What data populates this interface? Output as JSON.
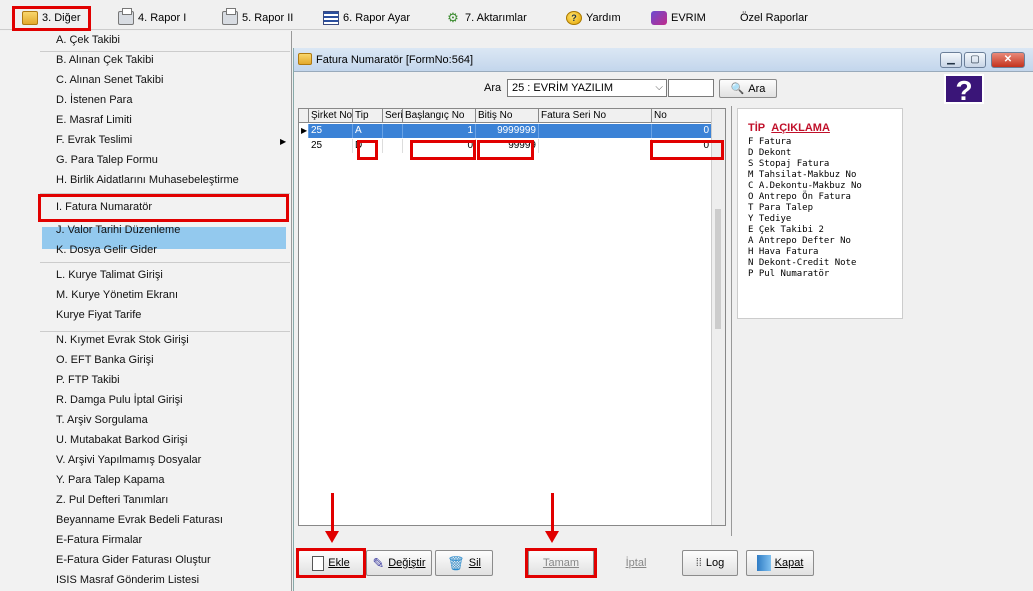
{
  "menubar": {
    "items": [
      {
        "label": "3. Diğer",
        "icon": "folder-icon"
      },
      {
        "label": "4. Rapor I",
        "icon": "printer-icon"
      },
      {
        "label": "5. Rapor II",
        "icon": "printer-icon"
      },
      {
        "label": "6. Rapor Ayar",
        "icon": "report-icon"
      },
      {
        "label": "7. Aktarımlar",
        "icon": "gears-icon"
      },
      {
        "label": "Yardım",
        "icon": "help-icon"
      },
      {
        "label": "EVRIM",
        "icon": "evrim-icon"
      },
      {
        "label": "Özel Raporlar",
        "icon": ""
      }
    ]
  },
  "dropdown": {
    "items": [
      "A. Çek Takibi",
      "B. Alınan Çek Takibi",
      "C. Alınan Senet Takibi",
      "D. İstenen Para",
      "E. Masraf Limiti",
      "F. Evrak Teslimi",
      "G. Para Talep Formu",
      "H. Birlik Aidatlarını Muhasebeleştirme",
      "I. Fatura Numaratör",
      "J. Valor Tarihi Düzenleme",
      "K. Dosya Gelir Gider",
      "L. Kurye Talimat Girişi",
      "M. Kurye Yönetim Ekranı",
      "Kurye Fiyat Tarife",
      "N. Kıymet Evrak Stok Girişi",
      "O. EFT Banka Girişi",
      "P. FTP Takibi",
      "R. Damga Pulu İptal Girişi",
      "T. Arşiv Sorgulama",
      "U. Mutabakat Barkod Girişi",
      "V. Arşivi Yapılmamış Dosyalar",
      "Y. Para Talep Kapama",
      "Z. Pul Defteri Tanımları",
      "Beyanname Evrak Bedeli Faturası",
      "E-Fatura Firmalar",
      "E-Fatura Gider Faturası Oluştur",
      "ISIS Masraf Gönderim Listesi"
    ],
    "selected": "I. Fatura Numaratör"
  },
  "window": {
    "title": "Fatura Numaratör [FormNo:564]",
    "search_label": "Ara",
    "search_value": "25 : EVRİM YAZILIM",
    "search_button": "Ara",
    "help_glyph": "?"
  },
  "grid": {
    "columns": [
      "Şirket No",
      "Tip",
      "Seri",
      "Başlangıç No",
      "Bitiş No",
      "Fatura Seri No",
      "No"
    ],
    "rows": [
      {
        "sirket": "25",
        "tip": "A",
        "seri": "",
        "bas": "1",
        "bit": "9999999",
        "fseri": "",
        "no": "0"
      },
      {
        "sirket": "25",
        "tip": "D",
        "seri": "",
        "bas": "0",
        "bit": "99999",
        "fseri": "",
        "no": "0"
      }
    ]
  },
  "explain": {
    "head_tip": "TİP",
    "head_aciklama": "AÇIKLAMA",
    "lines": [
      "F Fatura",
      "D Dekont",
      "S Stopaj Fatura",
      "M Tahsilat-Makbuz No",
      "C A.Dekontu-Makbuz No",
      "O Antrepo Ön Fatura",
      "T Para Talep",
      "Y Tediye",
      "E Çek Takibi 2",
      "A Antrepo Defter No",
      "H Hava Fatura",
      "N Dekont-Credit Note",
      "P Pul Numaratör"
    ]
  },
  "buttons": {
    "ekle": "Ekle",
    "degistir": "Değiştir",
    "sil": "Sil",
    "tamam": "Tamam",
    "iptal": "İptal",
    "log": "Log",
    "kapat": "Kapat"
  },
  "colors": {
    "highlight": "#e10000",
    "selection": "#3b82d6",
    "menu_selected": "#93c9ee",
    "accent_title": "#c0102a"
  }
}
